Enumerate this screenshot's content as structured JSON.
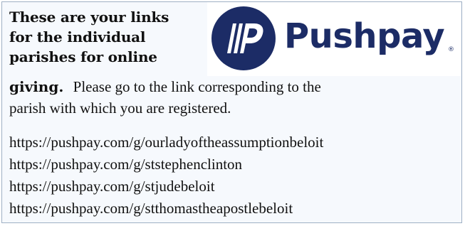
{
  "notice": {
    "heading_lines": [
      "These are your links",
      "for the individual",
      "parishes for online",
      "giving."
    ],
    "instruction_line1": "Please go to the link corresponding to the",
    "instruction_line2": "parish with which you are registered."
  },
  "logo": {
    "brand_name": "Pushpay",
    "registered_mark": "®",
    "mark_icon": "pushpay-p-logo-icon",
    "color": "#1c2c66"
  },
  "links": [
    "https://pushpay.com/g/ourladyoftheassumptionbeloit",
    "https://pushpay.com/g/ststephenclinton",
    "https://pushpay.com/g/stjudebeloit",
    "https://pushpay.com/g/stthomastheapostlebeloit"
  ]
}
